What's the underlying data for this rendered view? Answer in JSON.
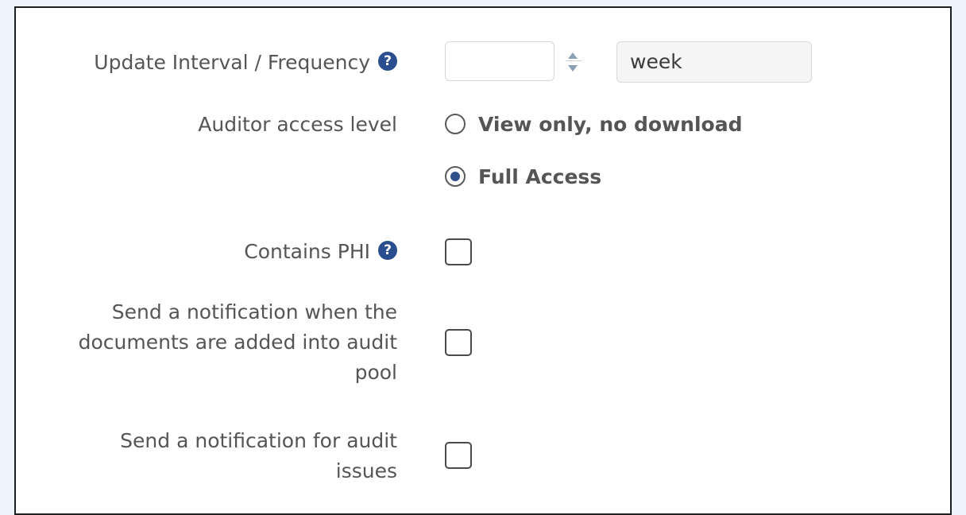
{
  "form": {
    "update_interval": {
      "label": "Update Interval / Frequency",
      "help_icon": "question-circle-icon",
      "number_value": "",
      "unit_value": "week"
    },
    "auditor_access": {
      "label": "Auditor access level",
      "options": [
        {
          "label": "View only, no download",
          "checked": false
        },
        {
          "label": "Full Access",
          "checked": true
        }
      ]
    },
    "contains_phi": {
      "label": "Contains PHI",
      "help_icon": "question-circle-icon",
      "checked": false
    },
    "notify_audit_pool": {
      "label": "Send a notification when the documents are added into audit pool",
      "checked": false
    },
    "notify_audit_issues": {
      "label": "Send a notification for audit issues",
      "checked": false
    }
  },
  "colors": {
    "accent": "#2a4d8f",
    "page_background": "#eef4fb",
    "label_text": "#555555"
  }
}
